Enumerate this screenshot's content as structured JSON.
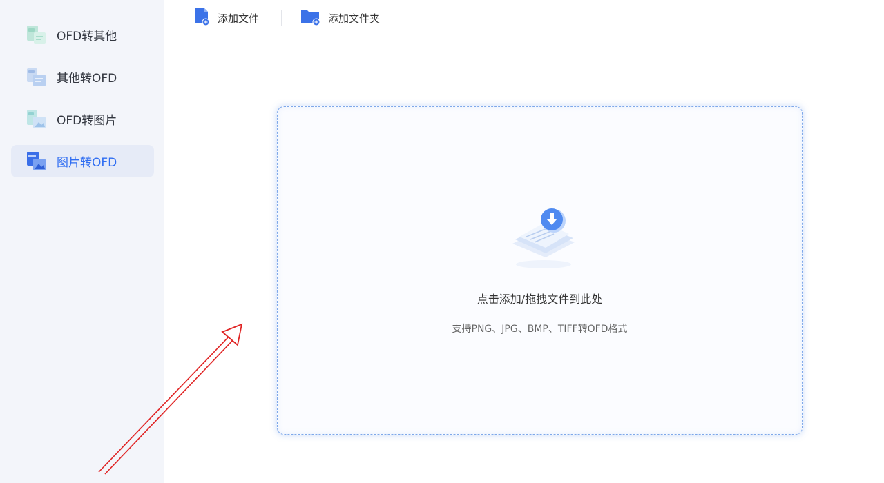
{
  "sidebar": {
    "items": [
      {
        "label": "OFD转其他",
        "icon": "ofd-to-other-icon",
        "active": false
      },
      {
        "label": "其他转OFD",
        "icon": "other-to-ofd-icon",
        "active": false
      },
      {
        "label": "OFD转图片",
        "icon": "ofd-to-image-icon",
        "active": false
      },
      {
        "label": "图片转OFD",
        "icon": "image-to-ofd-icon",
        "active": true
      }
    ]
  },
  "toolbar": {
    "add_file_label": "添加文件",
    "add_folder_label": "添加文件夹"
  },
  "dropzone": {
    "title": "点击添加/拖拽文件到此处",
    "subtitle": "支持PNG、JPG、BMP、TIFF转OFD格式"
  },
  "colors": {
    "accent": "#2f6df2",
    "sidebar_bg": "#f3f5fa",
    "active_bg": "#e6ebf7",
    "annotation_arrow": "#e02424"
  }
}
